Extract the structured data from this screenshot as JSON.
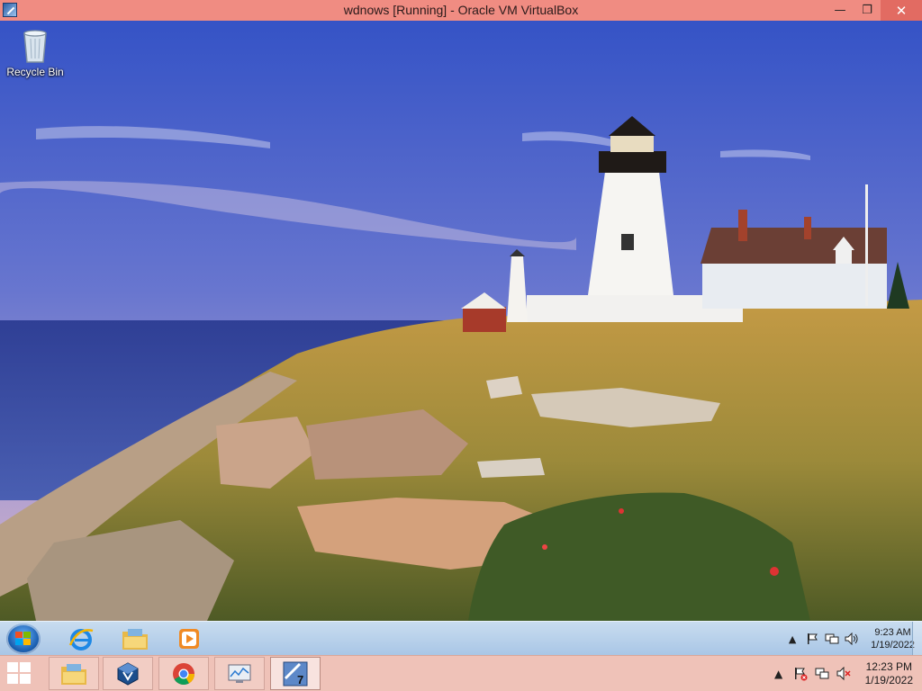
{
  "window": {
    "title": "wdnows [Running] - Oracle VM VirtualBox",
    "minimize_glyph": "—",
    "restore_glyph": "❐",
    "close_glyph": "✕"
  },
  "desktop": {
    "icons": [
      {
        "label": "Recycle Bin",
        "icon": "recycle-bin-icon"
      }
    ]
  },
  "guest_taskbar": {
    "pinned": [
      "internet-explorer-icon",
      "file-explorer-icon",
      "media-player-icon"
    ],
    "tray": {
      "expand_glyph": "▲",
      "time": "9:23 AM",
      "date": "1/19/2022"
    }
  },
  "host_taskbar": {
    "apps": [
      "file-explorer-icon",
      "virtualbox-icon",
      "chrome-icon",
      "resource-monitor-icon",
      "windows7-vm-icon"
    ],
    "active_app": "windows7-vm-icon",
    "vm_badge": "7",
    "tray": {
      "expand_glyph": "▲",
      "time": "12:23 PM",
      "date": "1/19/2022"
    }
  },
  "colors": {
    "host_titlebar": "#f08c82",
    "host_taskbar": "#efc2b8",
    "guest_taskbar": "#b7d0ea"
  }
}
